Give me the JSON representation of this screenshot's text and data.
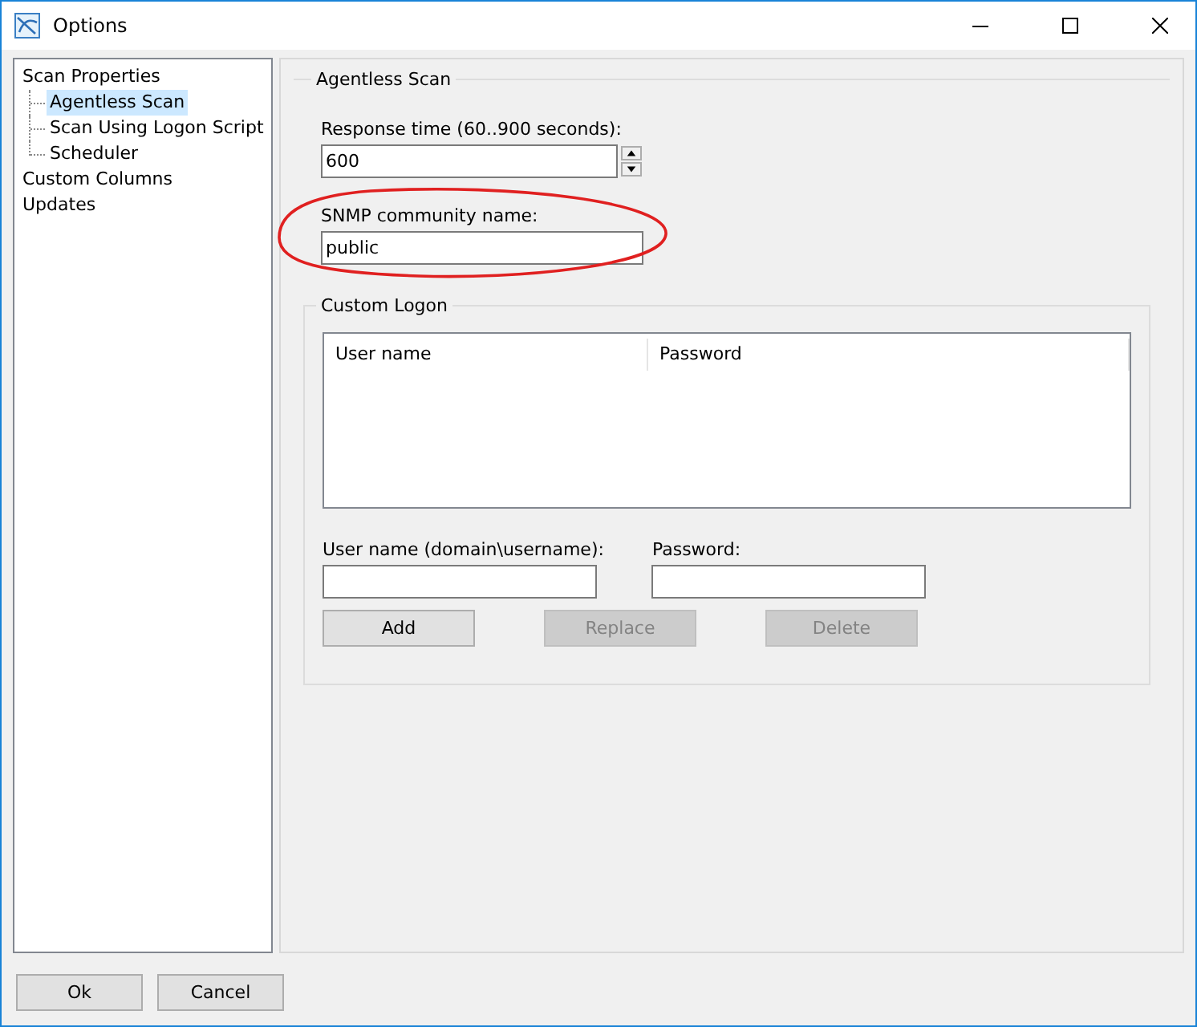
{
  "window": {
    "title": "Options"
  },
  "tree": [
    {
      "label": "Scan Properties",
      "selected": false,
      "children": [
        {
          "label": "Agentless Scan",
          "selected": true
        },
        {
          "label": "Scan Using Logon Script",
          "selected": false
        },
        {
          "label": "Scheduler",
          "selected": false
        }
      ]
    },
    {
      "label": "Custom Columns",
      "selected": false
    },
    {
      "label": "Updates",
      "selected": false
    }
  ],
  "agentless_scan": {
    "title": "Agentless Scan",
    "response_time": {
      "label": "Response time (60..900 seconds):",
      "value": "600"
    },
    "snmp": {
      "label": "SNMP community name:",
      "value": "public",
      "annotated": true
    },
    "custom_logon": {
      "title": "Custom Logon",
      "columns": [
        "User name",
        "Password"
      ],
      "user_field": {
        "label": "User name (domain\\username):"
      },
      "password_field": {
        "label": "Password:"
      },
      "buttons": [
        {
          "label": "Add",
          "disabled": false
        },
        {
          "label": "Replace",
          "disabled": true
        },
        {
          "label": "Delete",
          "disabled": true
        }
      ]
    }
  },
  "footer_buttons": [
    "Ok",
    "Cancel"
  ]
}
